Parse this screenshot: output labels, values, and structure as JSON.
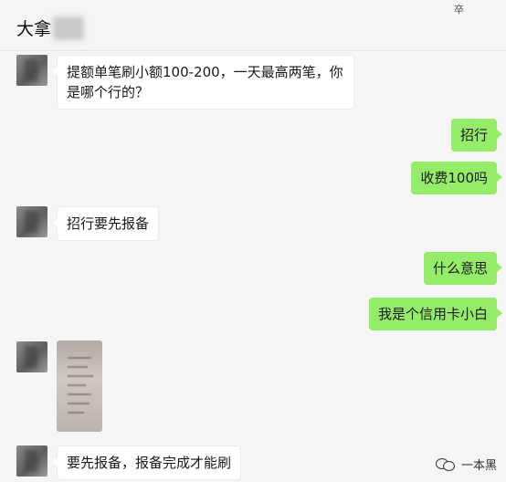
{
  "header": {
    "title": "大拿",
    "pin_glyph": "卒"
  },
  "messages": [
    {
      "side": "left",
      "text": "提额单笔刷小额100-200，一天最高两笔，你是哪个行的？"
    },
    {
      "side": "right",
      "text": "招行"
    },
    {
      "side": "right",
      "text": "收费100吗"
    },
    {
      "side": "left",
      "text": "招行要先报备"
    },
    {
      "side": "right",
      "text": "什么意思"
    },
    {
      "side": "right",
      "text": "我是个信用卡小白"
    },
    {
      "side": "left",
      "type": "image"
    },
    {
      "side": "left",
      "text": "要先报备，报备完成才能刷"
    }
  ],
  "watermark": {
    "text": "一本黑"
  },
  "colors": {
    "background": "#f5f5f5",
    "sent_bubble": "#95ec69",
    "received_bubble": "#ffffff"
  }
}
